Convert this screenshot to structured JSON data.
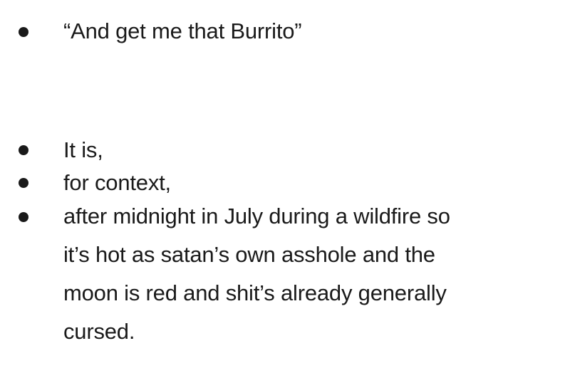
{
  "bullets": [
    {
      "text": "“And get me that Burrito”"
    },
    {
      "text": "It is,"
    },
    {
      "text": "for context,"
    },
    {
      "lines": [
        "after midnight in July during a wildfire so",
        "it’s hot as satan’s own asshole and the",
        "moon is red and shit’s already generally",
        "cursed."
      ]
    }
  ]
}
